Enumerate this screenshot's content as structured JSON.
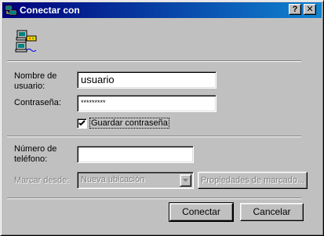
{
  "window": {
    "title": "Conectar con",
    "help_button": "?",
    "close_button": "✕"
  },
  "header": {
    "icon": "dialup-networking-computers-icon"
  },
  "form": {
    "username_label_line1": "Nombre de",
    "username_label_line2": "usuario:",
    "username_value": "usuario",
    "password_label": "Contraseña:",
    "password_value": "*********",
    "save_password_label": "Guardar contraseña",
    "save_password_checked": true,
    "phone_label_line1": "Número de",
    "phone_label_line2": "teléfono:",
    "phone_value": "",
    "dial_from_label": "Marcar desde:",
    "dial_from_value": "Nueva ubicación",
    "dial_properties_button": "Propiedades de marcado..."
  },
  "actions": {
    "connect": "Conectar",
    "cancel": "Cancelar"
  },
  "colors": {
    "title_gradient_start": "#00007b",
    "title_gradient_end": "#1084d0",
    "face": "#c0c0c0",
    "disabled_text": "#808080"
  }
}
